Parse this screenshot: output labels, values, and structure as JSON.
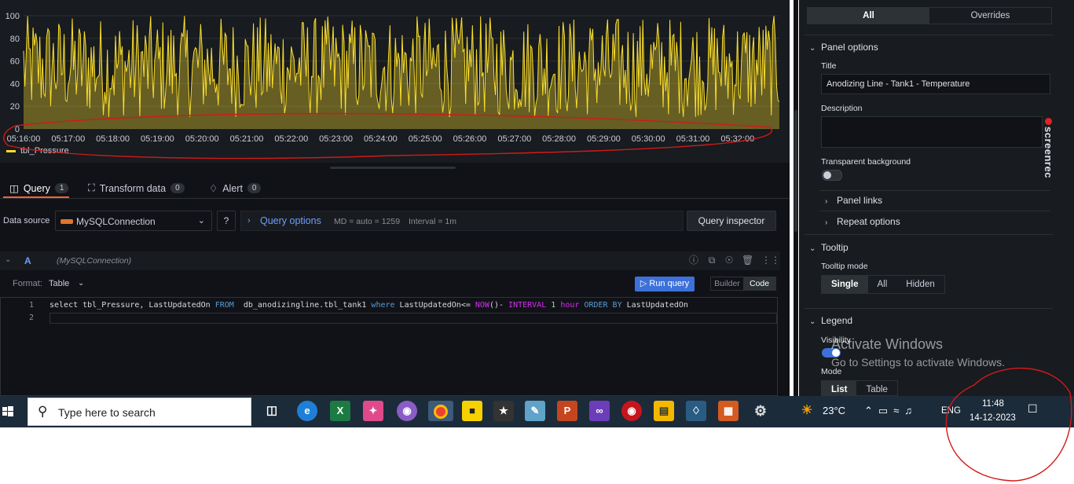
{
  "chart": {
    "y_ticks": [
      "100",
      "80",
      "60",
      "40",
      "20",
      "0"
    ],
    "x_ticks": [
      "05:16:00",
      "05:17:00",
      "05:18:00",
      "05:19:00",
      "05:20:00",
      "05:21:00",
      "05:22:00",
      "05:23:00",
      "05:24:00",
      "05:25:00",
      "05:26:00",
      "05:27:00",
      "05:28:00",
      "05:29:00",
      "05:30:00",
      "05:31:00",
      "05:32:00"
    ],
    "legend": "tbl_Pressure",
    "series_color": "#fade2a"
  },
  "chart_data": {
    "type": "line",
    "series": [
      {
        "name": "tbl_Pressure"
      }
    ],
    "x_ticks": [
      "05:16:00",
      "05:17:00",
      "05:18:00",
      "05:19:00",
      "05:20:00",
      "05:21:00",
      "05:22:00",
      "05:23:00",
      "05:24:00",
      "05:25:00",
      "05:26:00",
      "05:27:00",
      "05:28:00",
      "05:29:00",
      "05:30:00",
      "05:31:00",
      "05:32:00"
    ],
    "ylim": [
      0,
      100
    ],
    "y_ticks": [
      0,
      20,
      40,
      60,
      80,
      100
    ],
    "grid": true,
    "legend_position": "bottom-left"
  },
  "query_tabs": [
    {
      "label": "Query",
      "count": "1"
    },
    {
      "label": "Transform data",
      "count": "0"
    },
    {
      "label": "Alert",
      "count": "0"
    }
  ],
  "datasource": {
    "label": "Data source",
    "value": "MySQLConnection",
    "options_label": "Query options",
    "md": "MD = auto = 1259",
    "interval": "Interval = 1m",
    "inspector": "Query inspector"
  },
  "query": {
    "ref": "A",
    "ds": "(MySQLConnection)",
    "format_label": "Format:",
    "format_value": "Table",
    "run": "Run query",
    "builder": "Builder",
    "code": "Code",
    "line_numbers": [
      "1",
      "2"
    ],
    "sql": {
      "p1": "select tbl_Pressure, LastUpdatedOn ",
      "k1": "FROM",
      "p2": "  db_anodizingline.tbl_tank1 ",
      "k2": "where",
      "p3": " LastUpdatedOn<= ",
      "f1": "NOW",
      "p4": "()- ",
      "f2": "INTERVAL",
      "p5": " ",
      "n1": "1",
      "p6": " ",
      "f3": "hour",
      "p7": " ",
      "k3": "ORDER BY",
      "p8": " LastUpdatedOn"
    }
  },
  "options": {
    "tab_all": "All",
    "tab_overrides": "Overrides",
    "panel_options": "Panel options",
    "title_label": "Title",
    "title_value": "Anodizing Line - Tank1  - Temperature",
    "description_label": "Description",
    "transparent_label": "Transparent background",
    "panel_links": "Panel links",
    "repeat_options": "Repeat options",
    "tooltip": "Tooltip",
    "tooltip_mode_label": "Tooltip mode",
    "tooltip_modes": [
      "Single",
      "All",
      "Hidden"
    ],
    "legend": "Legend",
    "visibility_label": "Visibility",
    "mode_label": "Mode",
    "legend_modes": [
      "List",
      "Table"
    ],
    "screenrec": "screenrec"
  },
  "watermark": {
    "line1": "Activate Windows",
    "line2": "Go to Settings to activate Windows."
  },
  "taskbar": {
    "search_placeholder": "Type here to search",
    "temperature": "23°C",
    "language": "ENG",
    "time": "11:48",
    "date": "14-12-2023"
  }
}
